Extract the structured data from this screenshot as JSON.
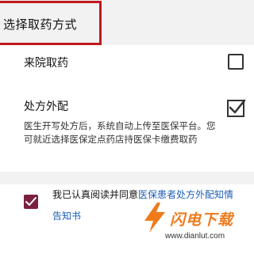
{
  "header": {
    "title": "选择取药方式"
  },
  "options": [
    {
      "label": "来院取药",
      "checked": false
    },
    {
      "label": "处方外配",
      "checked": true,
      "description": "医生开写处方后，系统自动上传至医保平台。您可就近选择医保定点药店持医保卡缴费取药"
    }
  ],
  "agreement": {
    "checked": true,
    "prefix": "我已认真阅读并同意",
    "link_text": "医保患者处方外配知情告知书"
  },
  "watermark": {
    "name": "闪电下载",
    "url": "www.dianlut.com"
  },
  "colors": {
    "highlight": "#c0181f",
    "checkbox_checked": "#7a1f3d",
    "link": "#1f5fb8",
    "watermark": "#f07a1a"
  }
}
